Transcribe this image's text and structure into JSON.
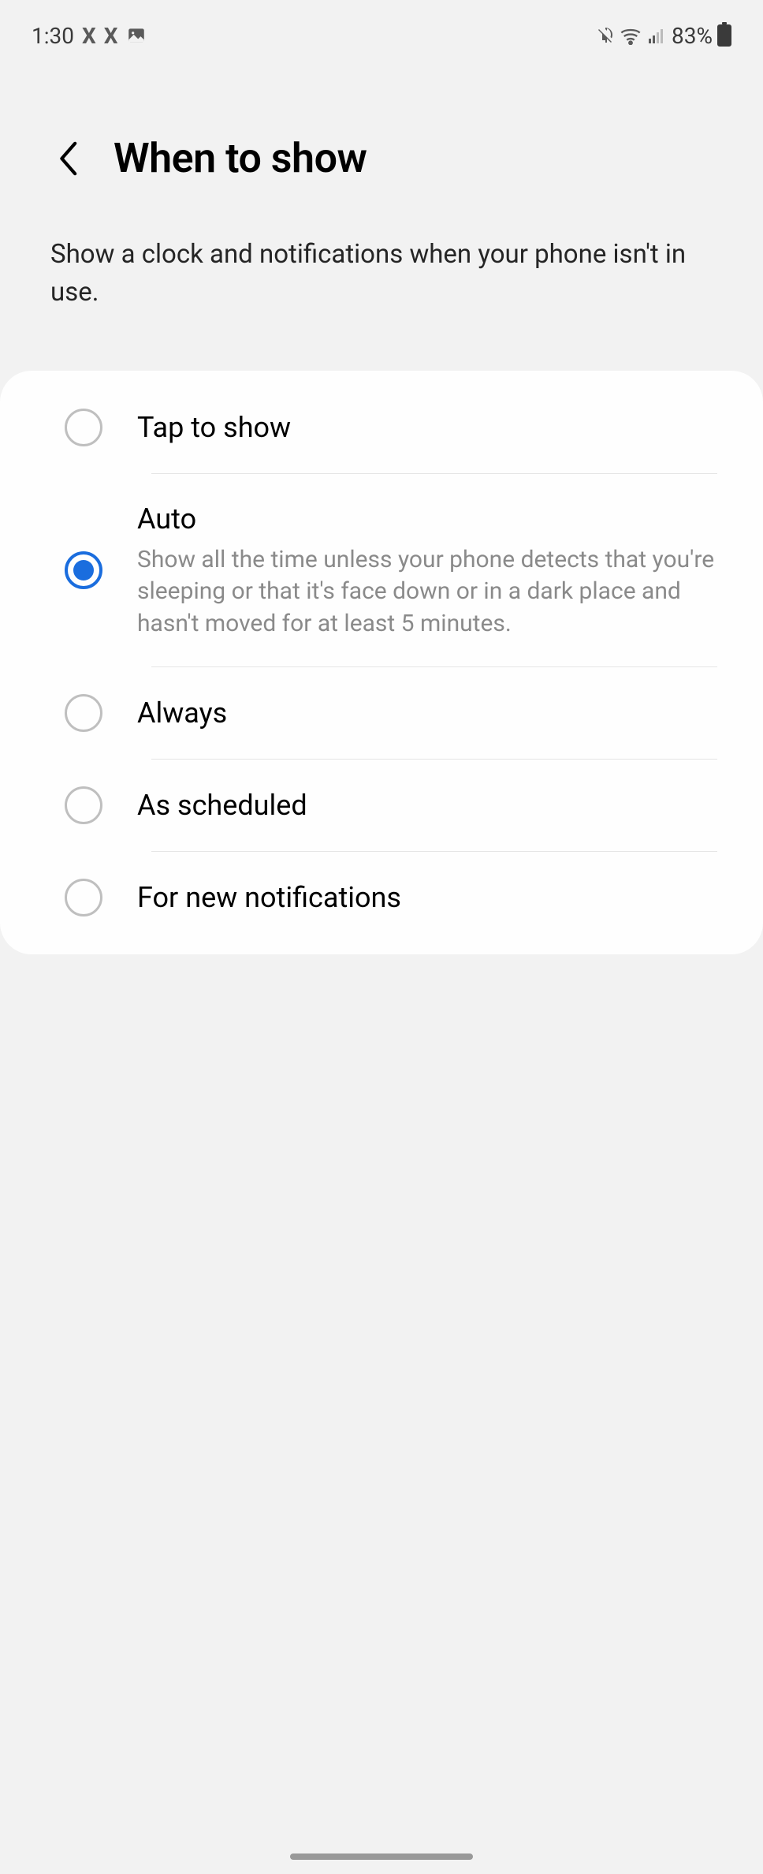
{
  "status_bar": {
    "time": "1:30",
    "battery_percent": "83%",
    "icons": {
      "x1": "X",
      "x2": "X",
      "image": "image-icon",
      "mute": "mute-icon",
      "wifi": "wifi-icon",
      "signal": "signal-icon",
      "battery": "battery-icon"
    }
  },
  "header": {
    "title": "When to show",
    "subtitle": "Show a clock and notifications when your phone isn't in use."
  },
  "options": [
    {
      "id": "tap_to_show",
      "label": "Tap to show",
      "description": "",
      "selected": false
    },
    {
      "id": "auto",
      "label": "Auto",
      "description": "Show all the time unless your phone detects that you're sleeping or that it's face down or in a dark place and hasn't moved for at least 5 minutes.",
      "selected": true
    },
    {
      "id": "always",
      "label": "Always",
      "description": "",
      "selected": false
    },
    {
      "id": "as_scheduled",
      "label": "As scheduled",
      "description": "",
      "selected": false
    },
    {
      "id": "for_new_notifications",
      "label": "For new notifications",
      "description": "",
      "selected": false
    }
  ]
}
